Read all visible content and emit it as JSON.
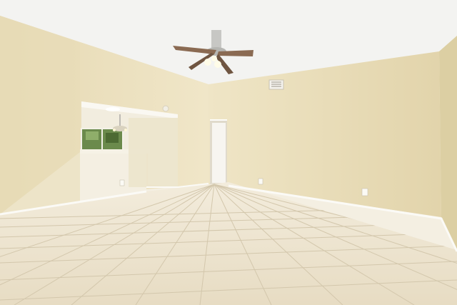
{
  "scene": {
    "kind": "photo-empty-room",
    "elements": [
      "vaulted-ceiling",
      "ceiling-fan",
      "beige-walls",
      "pass-through-opening",
      "doorway",
      "hvac-vent",
      "tile-floor",
      "baseboards",
      "wall-outlets",
      "window",
      "chandelier"
    ]
  },
  "colors": {
    "ceiling": "#f4f4f2",
    "wall_left": "#ece1bf",
    "wall_right": "#e9ddb9",
    "wall_far": "#efe6cc",
    "floor": "#ece2cc",
    "grout": "#d6cbb3",
    "baseboard": "#fbfaf6",
    "fan_blade": "#8a6a52",
    "fan_metal": "#b9b9b5",
    "window_green": "#5d7a3e"
  }
}
